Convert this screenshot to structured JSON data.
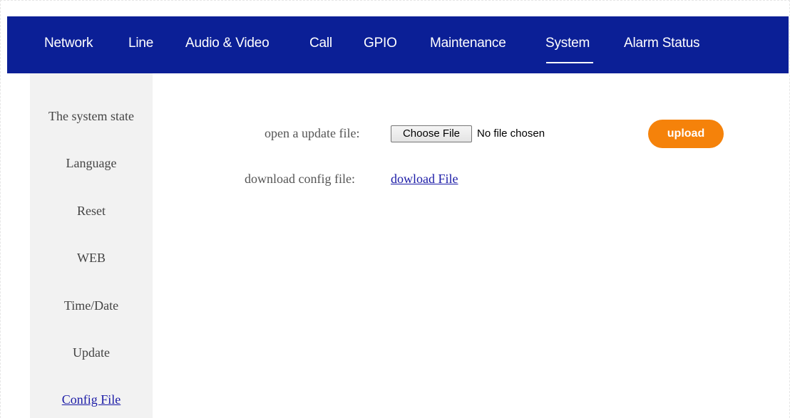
{
  "topnav": {
    "items": [
      {
        "label": "Network"
      },
      {
        "label": "Line"
      },
      {
        "label": "Audio & Video"
      },
      {
        "label": "Call"
      },
      {
        "label": "GPIO"
      },
      {
        "label": "Maintenance"
      },
      {
        "label": "System"
      },
      {
        "label": "Alarm Status"
      }
    ],
    "active": "System"
  },
  "sidebar": {
    "items": [
      {
        "label": "The system state"
      },
      {
        "label": "Language"
      },
      {
        "label": "Reset"
      },
      {
        "label": "WEB"
      },
      {
        "label": "Time/Date"
      },
      {
        "label": "Update"
      },
      {
        "label": "Config File"
      }
    ],
    "active": "Config File"
  },
  "main": {
    "update_label": "open a update file:",
    "choose_file_label": "Choose File",
    "no_file_text": "No file chosen",
    "upload_label": "upload",
    "download_label": "download config file:",
    "download_link": "dowload File"
  },
  "colors": {
    "nav_bg": "#0b1f96",
    "upload_bg": "#f5820a",
    "link": "#1a1aa6",
    "sidebar_bg": "#f2f2f2"
  }
}
